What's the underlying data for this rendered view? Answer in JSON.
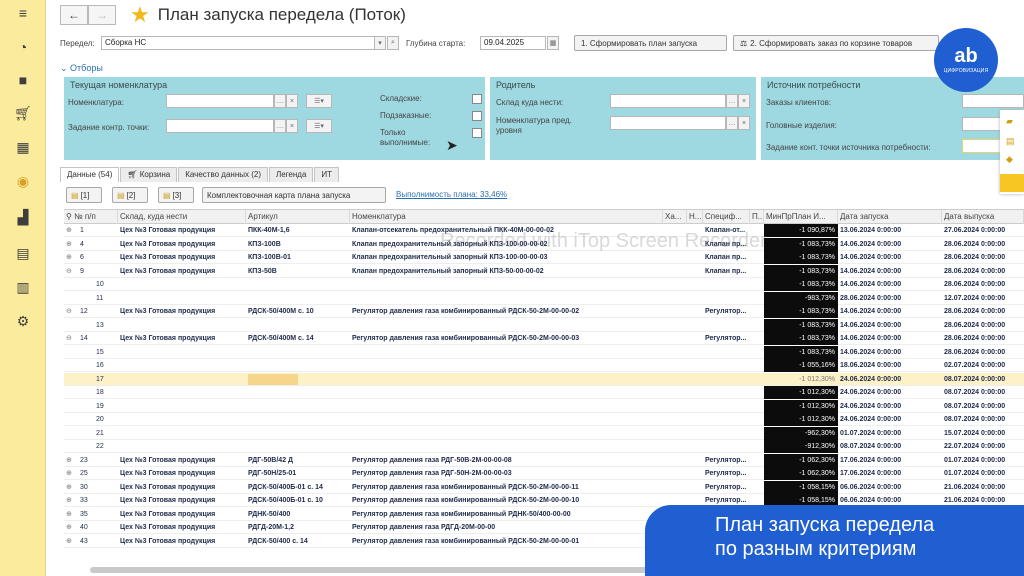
{
  "rail": {
    "icons": [
      "menu-icon",
      "pie-chart-icon",
      "bag-icon",
      "cart-icon",
      "grid-icon",
      "circle-chart-icon",
      "factory-icon",
      "reports-icon",
      "bar-chart-icon",
      "settings-icon"
    ]
  },
  "header": {
    "back": "←",
    "forward": "→",
    "title": "План запуска передела (Поток)"
  },
  "params": {
    "peredel_label": "Передел:",
    "peredel_value": "Сборка НС",
    "depth_label": "Глубина старта:",
    "depth_value": "09.04.2025",
    "btn1": "1. Сформировать план запуска",
    "btn2": "2. Сформировать заказ по корзине товаров"
  },
  "filters": {
    "toggle": "Отборы",
    "nom_panel": {
      "title": "Текущая номенклатура",
      "nom_label": "Номенклатура:",
      "task_label": "Задание контр. точки:",
      "warehouse_label": "Складские:",
      "ordered_label": "Подзаказные:",
      "only_label": "Только выполнимые:"
    },
    "parent_panel": {
      "title": "Родитель",
      "wh_label": "Склад куда нести:",
      "nom_label": "Номенклатура пред. уровня"
    },
    "source_panel": {
      "title": "Источник потребности",
      "orders_label": "Заказы клиентов:",
      "head_label": "Головные изделия:",
      "task_label": "Задание конт. точки источника потребности:"
    }
  },
  "tabs": [
    "Данные (54)",
    "Корзина",
    "Качество данных (2)",
    "Легенда",
    "ИТ"
  ],
  "toolbar": {
    "b1": "[1]",
    "b2": "[2]",
    "b3": "[3]",
    "card": "Комплектовочная карта плана запуска",
    "link": "Выполнимость плана: 33,46%"
  },
  "grid": {
    "headers": [
      "№ п/п",
      "Склад, куда нести",
      "Артикул",
      "Номенклатура",
      "Ха...",
      "Н...",
      "Специф...",
      "П...",
      "МинПрПлан И...",
      "Дата запуска",
      "Дата выпуска"
    ],
    "rows": [
      {
        "exp": "⊕",
        "n": "1",
        "wh": "Цех №3 Готовая продукция",
        "art": "ПКК-40М-1,6",
        "nom": "Клапан-отсекатель предохранительный ПКК-40М-00-00-02",
        "spec": "Клапан-от...",
        "pct": "-1 090,87%",
        "start": "13.06.2024 0:00:00",
        "end": "27.06.2024 0:00:00",
        "b": true,
        "dk": true
      },
      {
        "exp": "⊕",
        "n": "4",
        "wh": "Цех №3 Готовая продукция",
        "art": "КПЗ-100В",
        "nom": "Клапан предохранительный запорный КПЗ-100-00-00-02",
        "spec": "Клапан пр...",
        "pct": "-1 083,73%",
        "start": "14.06.2024 0:00:00",
        "end": "28.06.2024 0:00:00",
        "b": true,
        "dk": true
      },
      {
        "exp": "⊕",
        "n": "6",
        "wh": "Цех №3 Готовая продукция",
        "art": "КПЗ-100В-01",
        "nom": "Клапан предохранительный запорный КПЗ-100-00-00-03",
        "spec": "Клапан пр...",
        "pct": "-1 083,73%",
        "start": "14.06.2024 0:00:00",
        "end": "28.06.2024 0:00:00",
        "b": true,
        "dk": true
      },
      {
        "exp": "⊖",
        "n": "9",
        "wh": "Цех №3 Готовая продукция",
        "art": "КПЗ-50В",
        "nom": "Клапан предохранительный запорный КПЗ-50-00-00-02",
        "spec": "Клапан пр...",
        "pct": "-1 083,73%",
        "start": "14.06.2024 0:00:00",
        "end": "28.06.2024 0:00:00",
        "b": true,
        "dk": true
      },
      {
        "exp": "",
        "n": "10",
        "wh": "",
        "art": "",
        "nom": "",
        "spec": "",
        "pct": "-1 083,73%",
        "start": "14.06.2024 0:00:00",
        "end": "28.06.2024 0:00:00",
        "b": false,
        "dk": true
      },
      {
        "exp": "",
        "n": "11",
        "wh": "",
        "art": "",
        "nom": "",
        "spec": "",
        "pct": "-983,73%",
        "start": "28.06.2024 0:00:00",
        "end": "12.07.2024 0:00:00",
        "b": false,
        "dk": true
      },
      {
        "exp": "⊖",
        "n": "12",
        "wh": "Цех №3 Готовая продукция",
        "art": "РДСК-50/400М с. 10",
        "nom": "Регулятор давления газа комбинированный РДСК-50-2М-00-00-02",
        "spec": "Регулятор...",
        "pct": "-1 083,73%",
        "start": "14.06.2024 0:00:00",
        "end": "28.06.2024 0:00:00",
        "b": true,
        "dk": true
      },
      {
        "exp": "",
        "n": "13",
        "wh": "",
        "art": "",
        "nom": "",
        "spec": "",
        "pct": "-1 083,73%",
        "start": "14.06.2024 0:00:00",
        "end": "28.06.2024 0:00:00",
        "b": false,
        "dk": true
      },
      {
        "exp": "⊖",
        "n": "14",
        "wh": "Цех №3 Готовая продукция",
        "art": "РДСК-50/400М с. 14",
        "nom": "Регулятор давления газа комбинированный РДСК-50-2М-00-00-03",
        "spec": "Регулятор...",
        "pct": "-1 083,73%",
        "start": "14.06.2024 0:00:00",
        "end": "28.06.2024 0:00:00",
        "b": true,
        "dk": true
      },
      {
        "exp": "",
        "n": "15",
        "wh": "",
        "art": "",
        "nom": "",
        "spec": "",
        "pct": "-1 083,73%",
        "start": "14.06.2024 0:00:00",
        "end": "28.06.2024 0:00:00",
        "b": false,
        "dk": true
      },
      {
        "exp": "",
        "n": "16",
        "wh": "",
        "art": "",
        "nom": "",
        "spec": "",
        "pct": "-1 055,16%",
        "start": "18.06.2024 0:00:00",
        "end": "02.07.2024 0:00:00",
        "b": false,
        "dk": true
      },
      {
        "exp": "",
        "n": "17",
        "wh": "",
        "art": "",
        "nom": "",
        "spec": "",
        "pct": "-1 012,30%",
        "start": "24.06.2024 0:00:00",
        "end": "08.07.2024 0:00:00",
        "b": false,
        "dk": false,
        "sel": true
      },
      {
        "exp": "",
        "n": "18",
        "wh": "",
        "art": "",
        "nom": "",
        "spec": "",
        "pct": "-1 012,30%",
        "start": "24.06.2024 0:00:00",
        "end": "08.07.2024 0:00:00",
        "b": false,
        "dk": true
      },
      {
        "exp": "",
        "n": "19",
        "wh": "",
        "art": "",
        "nom": "",
        "spec": "",
        "pct": "-1 012,30%",
        "start": "24.06.2024 0:00:00",
        "end": "08.07.2024 0:00:00",
        "b": false,
        "dk": true
      },
      {
        "exp": "",
        "n": "20",
        "wh": "",
        "art": "",
        "nom": "",
        "spec": "",
        "pct": "-1 012,30%",
        "start": "24.06.2024 0:00:00",
        "end": "08.07.2024 0:00:00",
        "b": false,
        "dk": true
      },
      {
        "exp": "",
        "n": "21",
        "wh": "",
        "art": "",
        "nom": "",
        "spec": "",
        "pct": "-962,30%",
        "start": "01.07.2024 0:00:00",
        "end": "15.07.2024 0:00:00",
        "b": false,
        "dk": true
      },
      {
        "exp": "",
        "n": "22",
        "wh": "",
        "art": "",
        "nom": "",
        "spec": "",
        "pct": "-912,30%",
        "start": "08.07.2024 0:00:00",
        "end": "22.07.2024 0:00:00",
        "b": false,
        "dk": true
      },
      {
        "exp": "⊕",
        "n": "23",
        "wh": "Цех №3 Готовая продукция",
        "art": "РДГ-50В/42 Д",
        "nom": "Регулятор давления газа РДГ-50В-2М-00-00-08",
        "spec": "Регулятор...",
        "pct": "-1 062,30%",
        "start": "17.06.2024 0:00:00",
        "end": "01.07.2024 0:00:00",
        "b": true,
        "dk": true
      },
      {
        "exp": "⊕",
        "n": "25",
        "wh": "Цех №3 Готовая продукция",
        "art": "РДГ-50Н/25-01",
        "nom": "Регулятор давления газа РДГ-50Н-2М-00-00-03",
        "spec": "Регулятор...",
        "pct": "-1 062,30%",
        "start": "17.06.2024 0:00:00",
        "end": "01.07.2024 0:00:00",
        "b": true,
        "dk": true
      },
      {
        "exp": "⊕",
        "n": "30",
        "wh": "Цех №3 Готовая продукция",
        "art": "РДСК-50/400Б-01 с. 14",
        "nom": "Регулятор давления газа комбинированный РДСК-50-2М-00-00-11",
        "spec": "Регулятор...",
        "pct": "-1 058,15%",
        "start": "06.06.2024 0:00:00",
        "end": "21.06.2024 0:00:00",
        "b": true,
        "dk": true
      },
      {
        "exp": "⊕",
        "n": "33",
        "wh": "Цех №3 Готовая продукция",
        "art": "РДСК-50/400Б-01 с. 10",
        "nom": "Регулятор давления газа комбинированный РДСК-50-2М-00-00-10",
        "spec": "Регулятор...",
        "pct": "-1 058,15%",
        "start": "06.06.2024 0:00:00",
        "end": "21.06.2024 0:00:00",
        "b": true,
        "dk": true
      },
      {
        "exp": "⊕",
        "n": "35",
        "wh": "Цех №3 Готовая продукция",
        "art": "РДНК-50/400",
        "nom": "Регулятор давления газа комбинированный РДНК-50/400-00-00",
        "spec": "",
        "pct": "",
        "start": "",
        "end": "",
        "b": true,
        "dk": false
      },
      {
        "exp": "⊕",
        "n": "40",
        "wh": "Цех №3 Готовая продукция",
        "art": "РДГД-20М-1,2",
        "nom": "Регулятор давления газа РДГД-20М-00-00",
        "spec": "",
        "pct": "",
        "start": "",
        "end": "",
        "b": true,
        "dk": false
      },
      {
        "exp": "⊕",
        "n": "43",
        "wh": "Цех №3 Готовая продукция",
        "art": "РДСК-50/400 с. 14",
        "nom": "Регулятор давления газа комбинированный РДСК-50-2М-00-00-01",
        "spec": "",
        "pct": "",
        "start": "",
        "end": "",
        "b": true,
        "dk": false
      }
    ]
  },
  "logo": {
    "mark": "ab",
    "caption": "ЦИФРОВИЗАЦИЯ"
  },
  "banner": {
    "line1": "План запуска передела",
    "line2": "по разным критериям"
  },
  "watermark": "Recorded with iTop Screen Recorder"
}
